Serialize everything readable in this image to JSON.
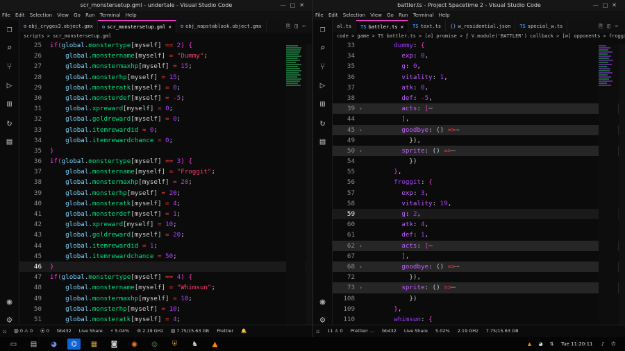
{
  "left": {
    "title": "scr_monstersetup.gml - undertale - Visual Studio Code",
    "menu": [
      "File",
      "Edit",
      "Selection",
      "View",
      "Go",
      "Run",
      "Terminal",
      "Help"
    ],
    "tabs": [
      {
        "label": "obj_cryges3.object.gmx",
        "active": false
      },
      {
        "label": "scr_monstersetup.gml",
        "active": true
      },
      {
        "label": "obj_napstablook.object.gmx",
        "active": false
      }
    ],
    "breadcrumb": "scripts > scr_monstersetup.gml",
    "status": [
      "⨂ 0 ⚠ 0",
      "⦿ 0",
      "Live Share",
      "⚡ 5.04%",
      "⚙ 2.19 GHz",
      "▤ 7.75/15.63 GB",
      "Prettier",
      "⊕"
    ],
    "status_branch": "bb432"
  },
  "right": {
    "title": "battler.ts - Project Spacetime 2 - Visual Studio Code",
    "menu": [
      "File",
      "Edit",
      "Selection",
      "View",
      "Go",
      "Run",
      "Terminal",
      "Help"
    ],
    "tabs": [
      {
        "label": "al.ts",
        "active": false,
        "ts": false
      },
      {
        "label": "battler.ts",
        "active": true,
        "ts": true
      },
      {
        "label": "text.ts",
        "active": false,
        "ts": true
      },
      {
        "label": "w_residential.json",
        "active": false,
        "ts": false
      },
      {
        "label": "special_w.ts",
        "active": false,
        "ts": true
      }
    ],
    "breadcrumb": "code > game > TS battler.ts > [∅] promise > ƒ V.module('BATTLER') callback > [∅] opponents > froggit",
    "status": [
      "11 ⚠ 0",
      "Prettier: ...",
      "bb432",
      "Live Share",
      "5.02%",
      "2.19 GHz",
      "7.75/15.63 GB"
    ]
  },
  "taskbar": {
    "clock": "Tue 11:20:11",
    "apps": [
      "terminal-icon",
      "files-icon",
      "discord-icon",
      "vscode-icon",
      "archive-icon",
      "app-icon",
      "firefox-icon",
      "chrome-icon",
      "shield-app-icon",
      "game-icon",
      "vlc-icon"
    ]
  }
}
